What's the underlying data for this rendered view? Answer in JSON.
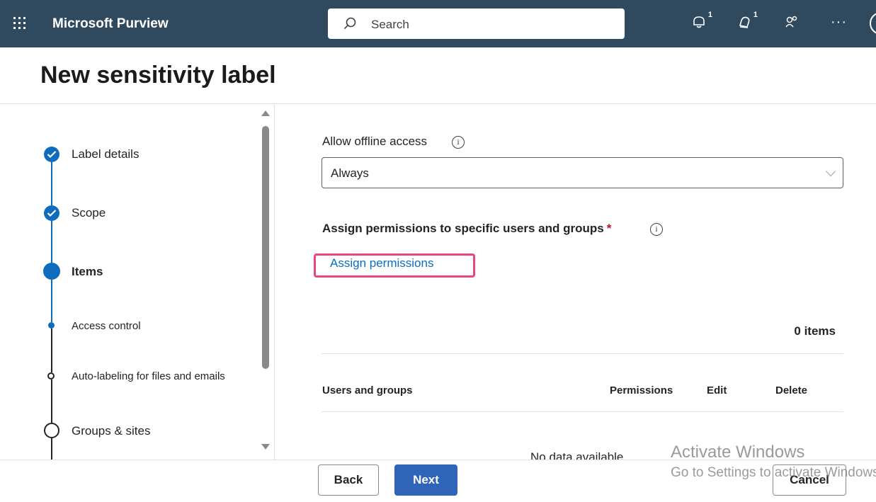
{
  "header": {
    "app_title": "Microsoft Purview",
    "search_placeholder": "Search",
    "notifications_badge": "1",
    "alerts_badge": "1",
    "more_label": "···",
    "icons": [
      "app-launcher-icon",
      "search-icon",
      "notifications-bell-icon",
      "alerts-bell-icon",
      "community-icon",
      "more-icon",
      "avatar"
    ]
  },
  "page": {
    "title": "New sensitivity label"
  },
  "wizard": {
    "steps": [
      {
        "label": "Label details",
        "state": "completed"
      },
      {
        "label": "Scope",
        "state": "completed"
      },
      {
        "label": "Items",
        "state": "current"
      },
      {
        "label": "Access control",
        "state": "current-substep"
      },
      {
        "label": "Auto-labeling for files and emails",
        "state": "pending-substep"
      },
      {
        "label": "Groups & sites",
        "state": "pending"
      }
    ]
  },
  "form": {
    "offline_access_label": "Allow offline access",
    "offline_access_value": "Always",
    "assign_section_title": "Assign permissions to specific users and groups",
    "required_marker": "*",
    "assign_link": "Assign permissions",
    "items_count": "0 items",
    "table": {
      "columns": [
        "Users and groups",
        "Permissions",
        "Edit",
        "Delete"
      ],
      "empty_message": "No data available"
    }
  },
  "footer": {
    "back_label": "Back",
    "next_label": "Next",
    "cancel_label": "Cancel"
  },
  "watermark": {
    "line1": "Activate Windows",
    "line2": "Go to Settings to activate Windows."
  },
  "colors": {
    "topbar": "#2f4a5f",
    "accent": "#0f6cbd",
    "next_button": "#2f64b8",
    "highlight": "#e8467c",
    "required": "#c50f1f"
  }
}
